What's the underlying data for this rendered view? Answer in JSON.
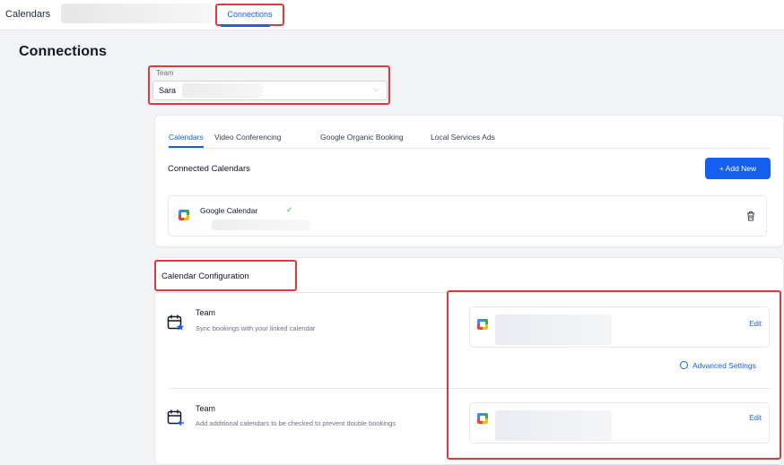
{
  "header": {
    "app_title": "Calendars",
    "active_tab": "Connections"
  },
  "page": {
    "title": "Connections"
  },
  "team_select": {
    "label": "Team",
    "value": "Sara"
  },
  "tabs": [
    {
      "label": "Calendars",
      "active": true
    },
    {
      "label": "Video Conferencing",
      "active": false
    },
    {
      "label": "Google Organic Booking",
      "active": false
    },
    {
      "label": "Local Services Ads",
      "active": false
    }
  ],
  "connected": {
    "title": "Connected Calendars",
    "add_button": "+ Add New",
    "items": [
      {
        "name": "Google Calendar",
        "status_icon": "check-icon"
      }
    ]
  },
  "configuration": {
    "title": "Calendar Configuration",
    "rows": [
      {
        "title": "Team",
        "description": "Sync bookings with your linked calendar",
        "edit_label": "Edit"
      },
      {
        "title": "Team",
        "description": "Add additional calendars to be checked to prevent double bookings",
        "edit_label": "Edit"
      }
    ],
    "advanced_settings": "Advanced Settings"
  },
  "colors": {
    "accent": "#155eef",
    "highlight": "#e0383e",
    "success": "#22c55e"
  }
}
